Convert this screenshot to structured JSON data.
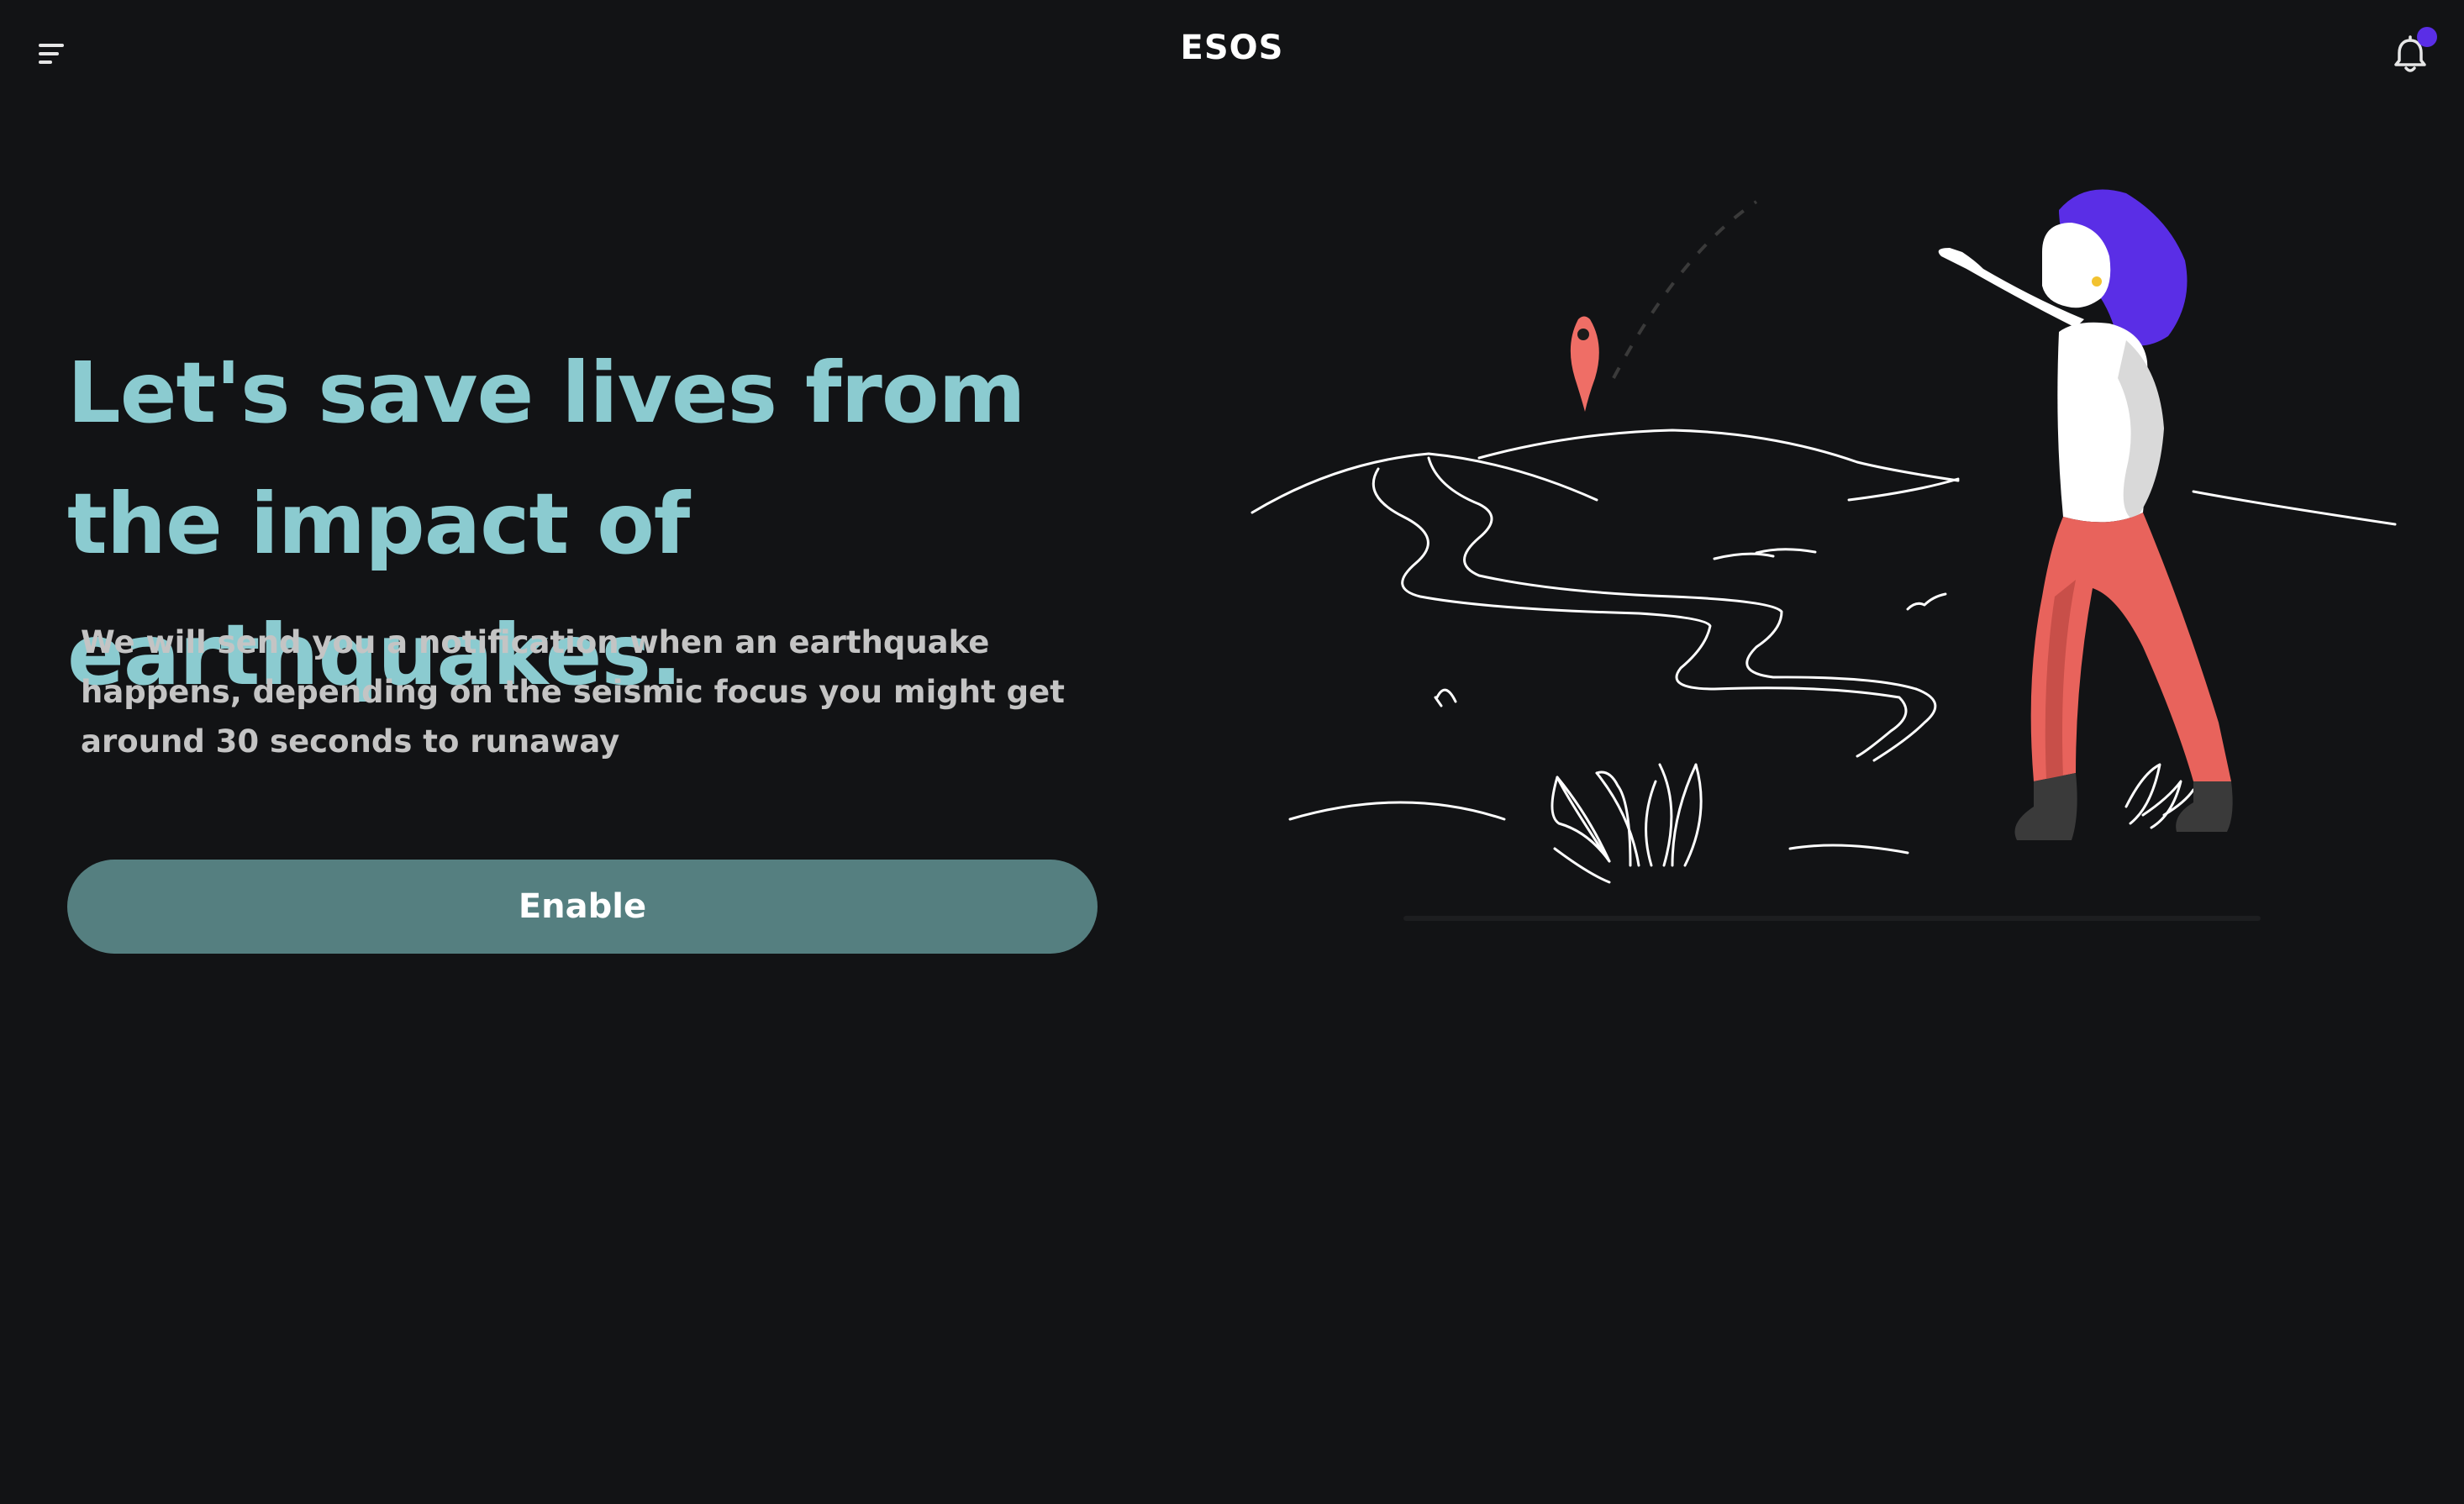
{
  "header": {
    "title": "ESOS",
    "menu_icon": "hamburger-menu-icon",
    "notification_icon": "bell-icon",
    "notification_dot_color": "#5a2ee6"
  },
  "hero": {
    "headline": "Let's save lives from the impact of earthquakes.",
    "description": "We will send you a notification when an earthquake happens, depending on the seismic focus you might get around 30 seconds to runaway",
    "button_label": "Enable"
  },
  "colors": {
    "background": "#121315",
    "headline": "#8bcbd0",
    "button": "#557f80",
    "pin": "#ef6e66",
    "hair": "#5a2ee6",
    "pants": "#e8635c"
  },
  "illustration": {
    "icon": "earthquake-landscape-illustration"
  }
}
